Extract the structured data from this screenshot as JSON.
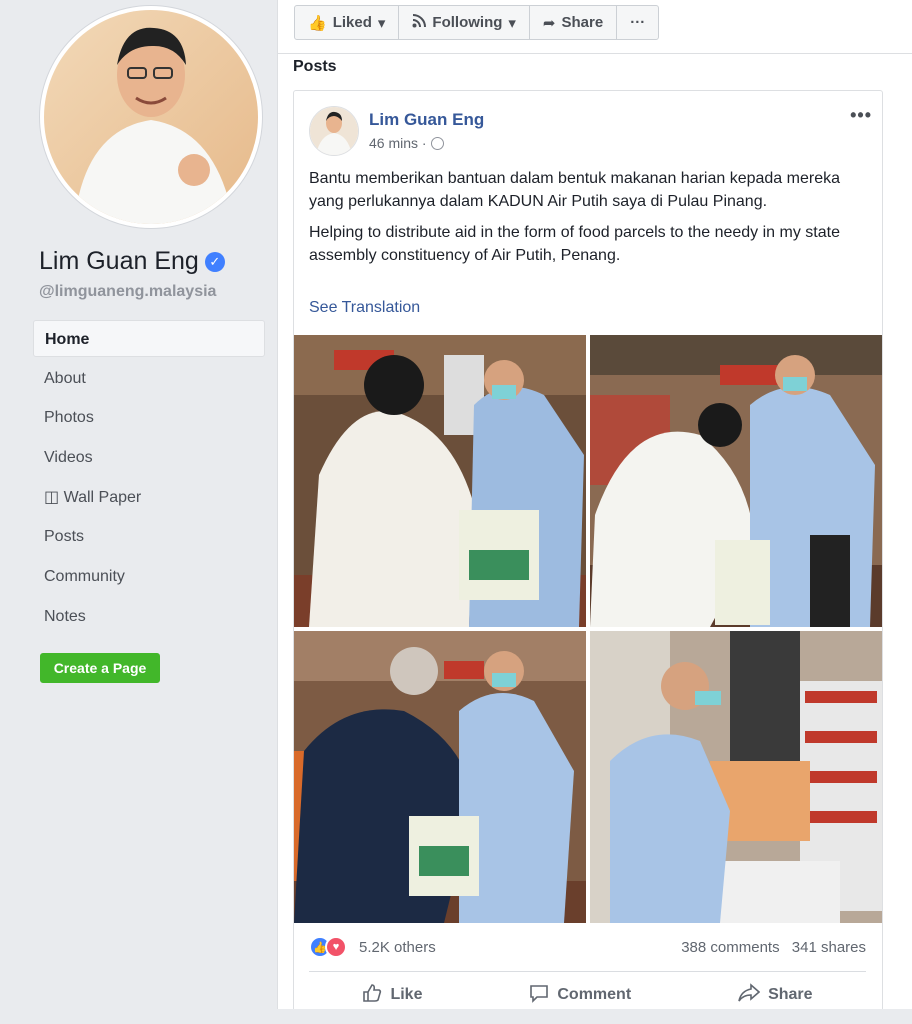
{
  "sidebar": {
    "page_name": "Lim Guan Eng",
    "handle": "@limguaneng.malaysia",
    "nav": [
      {
        "label": "Home",
        "active": true
      },
      {
        "label": "About"
      },
      {
        "label": "Photos"
      },
      {
        "label": "Videos"
      },
      {
        "label": "◫ Wall Paper"
      },
      {
        "label": "Posts"
      },
      {
        "label": "Community"
      },
      {
        "label": "Notes"
      }
    ],
    "create_page_label": "Create a Page"
  },
  "action_bar": {
    "liked_label": "Liked",
    "following_label": "Following",
    "share_label": "Share",
    "more_label": "···"
  },
  "section_title": "Posts",
  "post": {
    "author": "Lim Guan Eng",
    "time": "46 mins ·",
    "text_ms": "Bantu memberikan bantuan dalam bentuk makanan harian kepada mereka yang perlukannya dalam KADUN Air Putih saya di Pulau Pinang.",
    "text_en": "Helping to distribute aid in the form of food parcels to the needy in my state assembly constituency of Air Putih, Penang.",
    "see_translation": "See Translation",
    "reactions_count": "5.2K others",
    "comments": "388 comments",
    "shares": "341 shares",
    "actions": {
      "like": "Like",
      "comment": "Comment",
      "share": "Share"
    }
  },
  "colors": {
    "link": "#365899",
    "create_page_green": "#42b72a",
    "verified_blue": "#4080ff"
  }
}
